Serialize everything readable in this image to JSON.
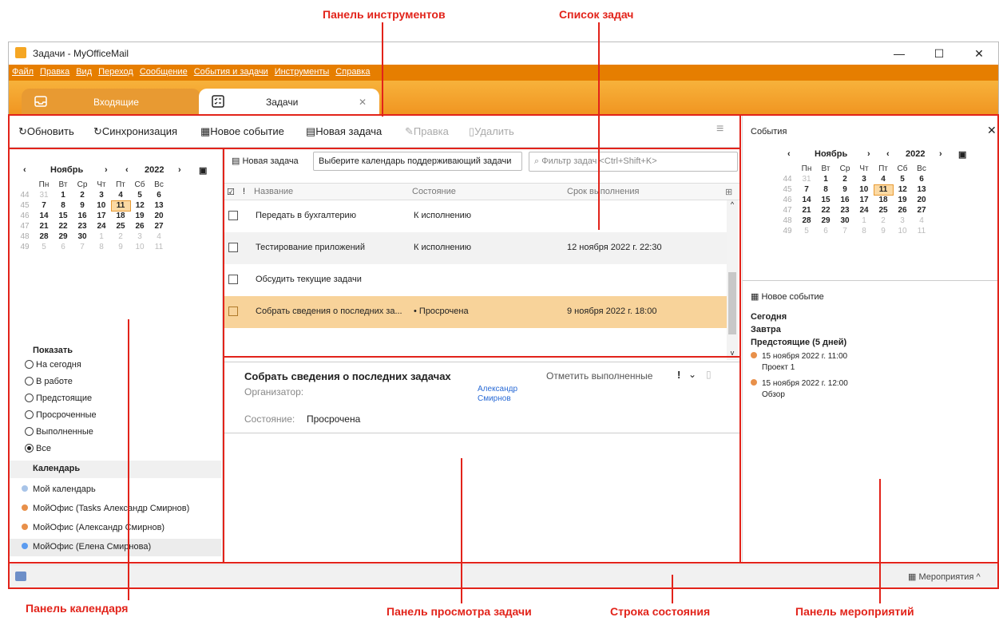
{
  "annotations": {
    "toolbar_panel": "Панель инструментов",
    "task_list": "Список задач",
    "calendar_panel": "Панель календаря",
    "task_view_panel": "Панель просмотра задачи",
    "status_bar": "Строка состояния",
    "events_panel": "Панель мероприятий"
  },
  "window": {
    "title": "Задачи - MyOfficeMail",
    "minimize": "—",
    "maximize": "☐",
    "close": "✕"
  },
  "menu": [
    "Файл",
    "Правка",
    "Вид",
    "Переход",
    "Сообщение",
    "События и задачи",
    "Инструменты",
    "Справка"
  ],
  "tabs": [
    {
      "label": "Входящие",
      "icon": "inbox-icon"
    },
    {
      "label": "Задачи",
      "icon": "tasks-icon",
      "close": "✕"
    }
  ],
  "toolbar": {
    "refresh": "Обновить",
    "sync": "Синхронизация",
    "new_event": "Новое событие",
    "new_task": "Новая задача",
    "edit": "Правка",
    "delete": "Удалить",
    "menu_icon": "≡"
  },
  "mini_calendar": {
    "month": "Ноябрь",
    "year": "2022",
    "weekdays": [
      "Пн",
      "Вт",
      "Ср",
      "Чт",
      "Пт",
      "Сб",
      "Вс"
    ],
    "weeks": [
      {
        "num": "44",
        "days": [
          "31",
          "1",
          "2",
          "3",
          "4",
          "5",
          "6"
        ]
      },
      {
        "num": "45",
        "days": [
          "7",
          "8",
          "9",
          "10",
          "11",
          "12",
          "13"
        ]
      },
      {
        "num": "46",
        "days": [
          "14",
          "15",
          "16",
          "17",
          "18",
          "19",
          "20"
        ]
      },
      {
        "num": "47",
        "days": [
          "21",
          "22",
          "23",
          "24",
          "25",
          "26",
          "27"
        ]
      },
      {
        "num": "48",
        "days": [
          "28",
          "29",
          "30",
          "1",
          "2",
          "3",
          "4"
        ]
      },
      {
        "num": "49",
        "days": [
          "5",
          "6",
          "7",
          "8",
          "9",
          "10",
          "11"
        ]
      }
    ],
    "today": "11"
  },
  "show": {
    "heading": "Показать",
    "options": [
      "На сегодня",
      "В работе",
      "Предстоящие",
      "Просроченные",
      "Выполненные",
      "Все"
    ],
    "selected": "Все"
  },
  "calendars": {
    "heading": "Календарь",
    "items": [
      {
        "name": "Мой календарь",
        "color": "#a8c4e8"
      },
      {
        "name": "МойОфис (Tasks Александр Смирнов)",
        "color": "#e8904a"
      },
      {
        "name": "МойОфис (Александр Смирнов)",
        "color": "#e8904a"
      },
      {
        "name": "МойОфис (Елена Смирнова)",
        "color": "#5b9bf0"
      }
    ]
  },
  "task_toolbar": {
    "new_task": "Новая задача",
    "select_calendar": "Выберите календарь поддерживающий задачи",
    "filter_placeholder": "Фильтр задач <Ctrl+Shift+K>"
  },
  "columns": [
    "Название",
    "Состояние",
    "Срок выполнения"
  ],
  "tasks": [
    {
      "title": "Передать в бухгалтерию",
      "status": "К исполнению",
      "due": ""
    },
    {
      "title": "Тестирование приложений",
      "status": "К исполнению",
      "due": "12 ноября 2022 г. 22:30"
    },
    {
      "title": "Обсудить текущие задачи",
      "status": "",
      "due": ""
    },
    {
      "title": "Собрать сведения о последних за...",
      "status": "• Просрочена",
      "due": "9 ноября 2022 г. 18:00"
    }
  ],
  "detail": {
    "title": "Собрать сведения о последних задачах",
    "mark_done": "Отметить выполненные",
    "organizer_label": "Организатор:",
    "organizer_name_1": "Александр",
    "organizer_name_2": "Смирнов",
    "state_label": "Состояние:",
    "state_value": "Просрочена"
  },
  "events_panel": {
    "title": "События",
    "new_event": "Новое событие",
    "today": "Сегодня",
    "tomorrow": "Завтра",
    "upcoming": "Предстоящие (5 дней)",
    "events": [
      {
        "date": "15 ноября 2022 г. 11:00",
        "name": "Проект 1",
        "color": "#e8904a"
      },
      {
        "date": "15 ноября 2022 г. 12:00",
        "name": "Обзор",
        "color": "#e8904a"
      }
    ]
  },
  "statusbar": {
    "events_label": "Мероприятия"
  }
}
